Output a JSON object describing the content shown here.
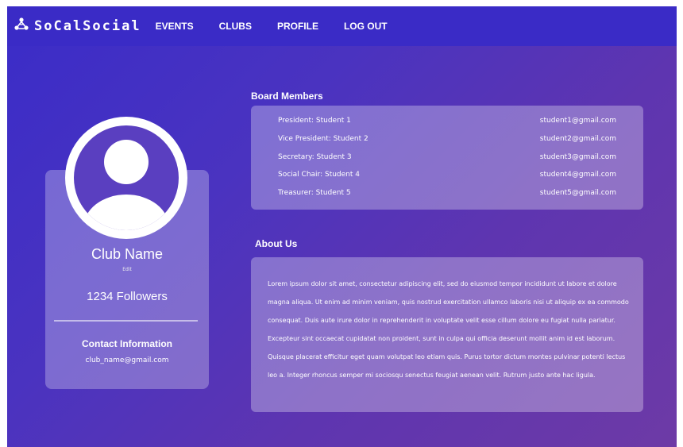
{
  "nav": {
    "logo_text": "SoCalSocial",
    "links": [
      {
        "label": "EVENTS"
      },
      {
        "label": "CLUBS"
      },
      {
        "label": "PROFILE"
      },
      {
        "label": "LOG OUT"
      }
    ]
  },
  "profile": {
    "club_name": "Club Name",
    "edit_label": "Edit",
    "followers": "1234 Followers",
    "contact_title": "Contact Information",
    "contact_email": "club_name@gmail.com"
  },
  "board": {
    "title": "Board Members",
    "members": [
      {
        "role": "President: Student 1",
        "email": "student1@gmail.com"
      },
      {
        "role": "Vice President: Student 2",
        "email": "student2@gmail.com"
      },
      {
        "role": "Secretary: Student 3",
        "email": "student3@gmail.com"
      },
      {
        "role": "Social Chair: Student 4",
        "email": "student4@gmail.com"
      },
      {
        "role": "Treasurer: Student 5",
        "email": "student5@gmail.com"
      }
    ]
  },
  "about": {
    "title": "About Us",
    "text": "Lorem ipsum dolor sit amet, consectetur adipiscing elit, sed do eiusmod tempor incididunt ut labore et dolore magna aliqua. Ut enim ad minim veniam, quis nostrud exercitation ullamco laboris nisi ut aliquip ex ea commodo consequat. Duis aute irure dolor in reprehenderit in voluptate velit esse cillum dolore eu fugiat nulla pariatur. Excepteur sint occaecat cupidatat non proident, sunt in culpa qui officia deserunt mollit anim id est laborum. Quisque placerat efficitur eget quam volutpat leo etiam quis. Purus tortor dictum montes pulvinar potenti lectus leo a. Integer rhoncus semper mi sociosqu senectus feugiat aenean velit. Rutrum justo ante hac ligula."
  }
}
